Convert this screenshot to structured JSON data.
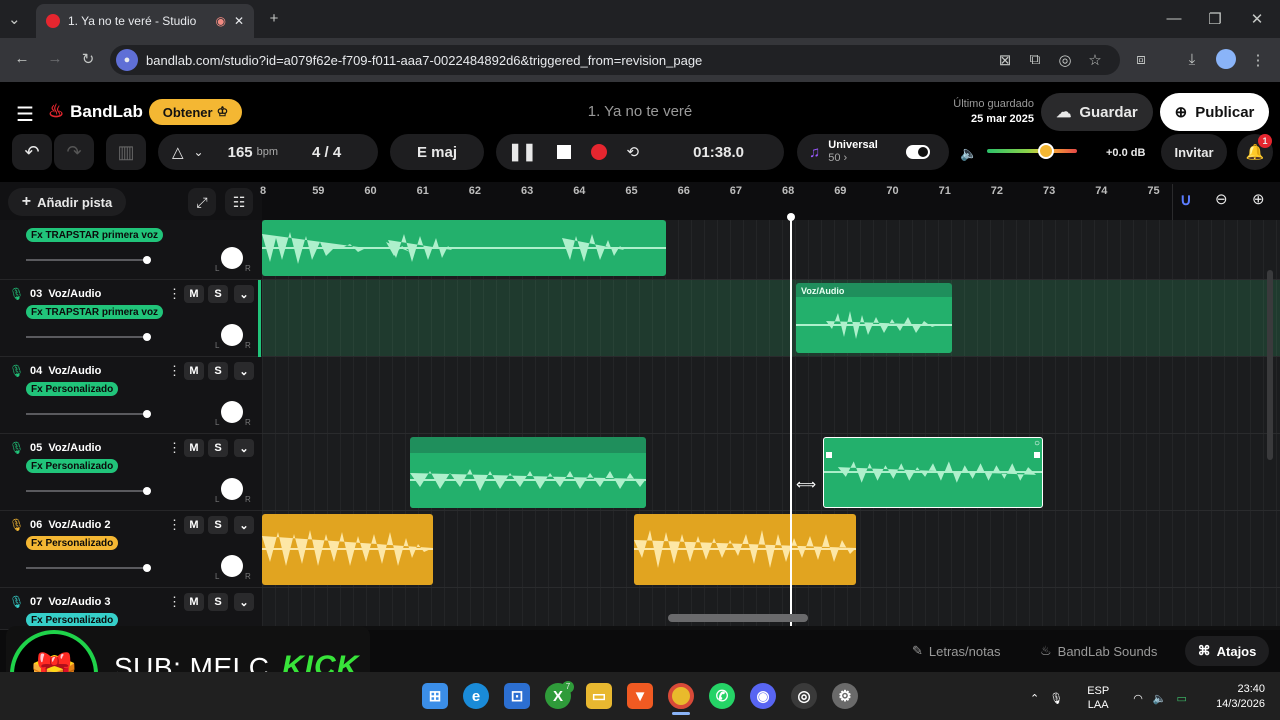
{
  "browser": {
    "tab_title": "1. Ya no te veré - Studio",
    "url": "bandlab.com/studio?id=a079f62e-f709-f011-aaa7-0022484892d6&triggered_from=revision_page"
  },
  "app": {
    "logo": "BandLab",
    "get_button": "Obtener",
    "song_title": "1. Ya no te veré",
    "saved_label": "Último guardado",
    "saved_date": "25 mar 2025",
    "save_button": "Guardar",
    "publish_button": "Publicar"
  },
  "transport": {
    "tempo": "165",
    "tempo_unit": "bpm",
    "time_sig": "4 / 4",
    "key": "E maj",
    "position": "01:38.0",
    "preset_name": "Universal",
    "preset_level": "50",
    "gain": "+0.0 dB",
    "invite": "Invitar",
    "notifications": "1",
    "meter_level_percent": 66
  },
  "toolbar": {
    "add_track": "Añadir pista"
  },
  "ruler": {
    "bars": [
      "8",
      "59",
      "60",
      "61",
      "62",
      "63",
      "64",
      "65",
      "66",
      "67",
      "68",
      "69",
      "70",
      "71",
      "72",
      "73",
      "74",
      "75"
    ]
  },
  "tracks": [
    {
      "number": "",
      "name": "",
      "fx": "Fx TRAPSTAR primera voz",
      "color": "#21c47a",
      "mic_color": "#21c47a"
    },
    {
      "number": "03",
      "name": "Voz/Audio",
      "fx": "Fx TRAPSTAR primera voz",
      "color": "#21c47a",
      "mic_color": "#21c47a"
    },
    {
      "number": "04",
      "name": "Voz/Audio",
      "fx": "Fx Personalizado",
      "color": "#21c47a",
      "mic_color": "#21c47a"
    },
    {
      "number": "05",
      "name": "Voz/Audio",
      "fx": "Fx Personalizado",
      "color": "#21c47a",
      "mic_color": "#21c47a"
    },
    {
      "number": "06",
      "name": "Voz/Audio 2",
      "fx": "Fx Personalizado",
      "color": "#f4b733",
      "mic_color": "#f4b733"
    },
    {
      "number": "07",
      "name": "Voz/Audio 3",
      "fx": "Fx Personalizado",
      "color": "#36cfc9",
      "mic_color": "#36cfc9"
    }
  ],
  "track_controls": {
    "mute": "M",
    "solo": "S",
    "left": "L",
    "right": "R"
  },
  "clips": {
    "region_label": "Voz/Audio"
  },
  "bottom": {
    "lyrics": "Letras/notas",
    "sounds": "BandLab Sounds",
    "shortcuts": "Atajos"
  },
  "overlay": {
    "sub_text": "SUB: MELC",
    "brand_text": "KICK"
  },
  "taskbar": {
    "lang_1": "ESP",
    "lang_2": "LAA",
    "time": "23:40",
    "date": "14/3/2026",
    "badge": "7"
  },
  "colors": {
    "accent_green": "#21c47a",
    "accent_orange": "#f4b733",
    "record_red": "#e5262f"
  }
}
